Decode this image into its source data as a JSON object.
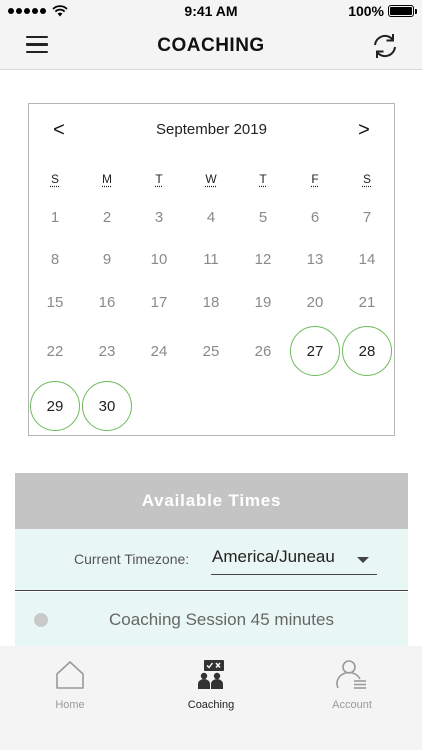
{
  "status_bar": {
    "time": "9:41 AM",
    "battery_text": "100%",
    "battery_level": 1.0
  },
  "nav": {
    "title": "COACHING",
    "menu_icon": "hamburger-menu-icon",
    "sync_icon": "sync-arrows-icon"
  },
  "calendar": {
    "month_label": "September 2019",
    "prev_label": "<",
    "next_label": ">",
    "weekdays": [
      "S",
      "M",
      "T",
      "W",
      "T",
      "F",
      "S"
    ],
    "weeks": [
      [
        {
          "day": "1",
          "available": false
        },
        {
          "day": "2",
          "available": false
        },
        {
          "day": "3",
          "available": false
        },
        {
          "day": "4",
          "available": false
        },
        {
          "day": "5",
          "available": false
        },
        {
          "day": "6",
          "available": false
        },
        {
          "day": "7",
          "available": false
        }
      ],
      [
        {
          "day": "8",
          "available": false
        },
        {
          "day": "9",
          "available": false
        },
        {
          "day": "10",
          "available": false
        },
        {
          "day": "11",
          "available": false
        },
        {
          "day": "12",
          "available": false
        },
        {
          "day": "13",
          "available": false
        },
        {
          "day": "14",
          "available": false
        }
      ],
      [
        {
          "day": "15",
          "available": false
        },
        {
          "day": "16",
          "available": false
        },
        {
          "day": "17",
          "available": false
        },
        {
          "day": "18",
          "available": false
        },
        {
          "day": "19",
          "available": false
        },
        {
          "day": "20",
          "available": false
        },
        {
          "day": "21",
          "available": false
        }
      ],
      [
        {
          "day": "22",
          "available": false
        },
        {
          "day": "23",
          "available": false
        },
        {
          "day": "24",
          "available": false
        },
        {
          "day": "25",
          "available": false
        },
        {
          "day": "26",
          "available": false
        },
        {
          "day": "27",
          "available": true
        },
        {
          "day": "28",
          "available": true
        }
      ],
      [
        {
          "day": "29",
          "available": true
        },
        {
          "day": "30",
          "available": true
        }
      ]
    ],
    "available_ring_color": "#6dba5b"
  },
  "available_times": {
    "header": "Available Times",
    "timezone_label": "Current Timezone:",
    "timezone_value": "America/Juneau",
    "sessions": [
      {
        "label": "Coaching Session 45 minutes",
        "selected": false
      }
    ],
    "background_color": "#e9f7f4",
    "header_color": "#c4c4c4"
  },
  "tabs": [
    {
      "label": "Home",
      "icon": "home-icon",
      "active": false
    },
    {
      "label": "Coaching",
      "icon": "coaching-icon",
      "active": true
    },
    {
      "label": "Account",
      "icon": "account-icon",
      "active": false
    }
  ]
}
